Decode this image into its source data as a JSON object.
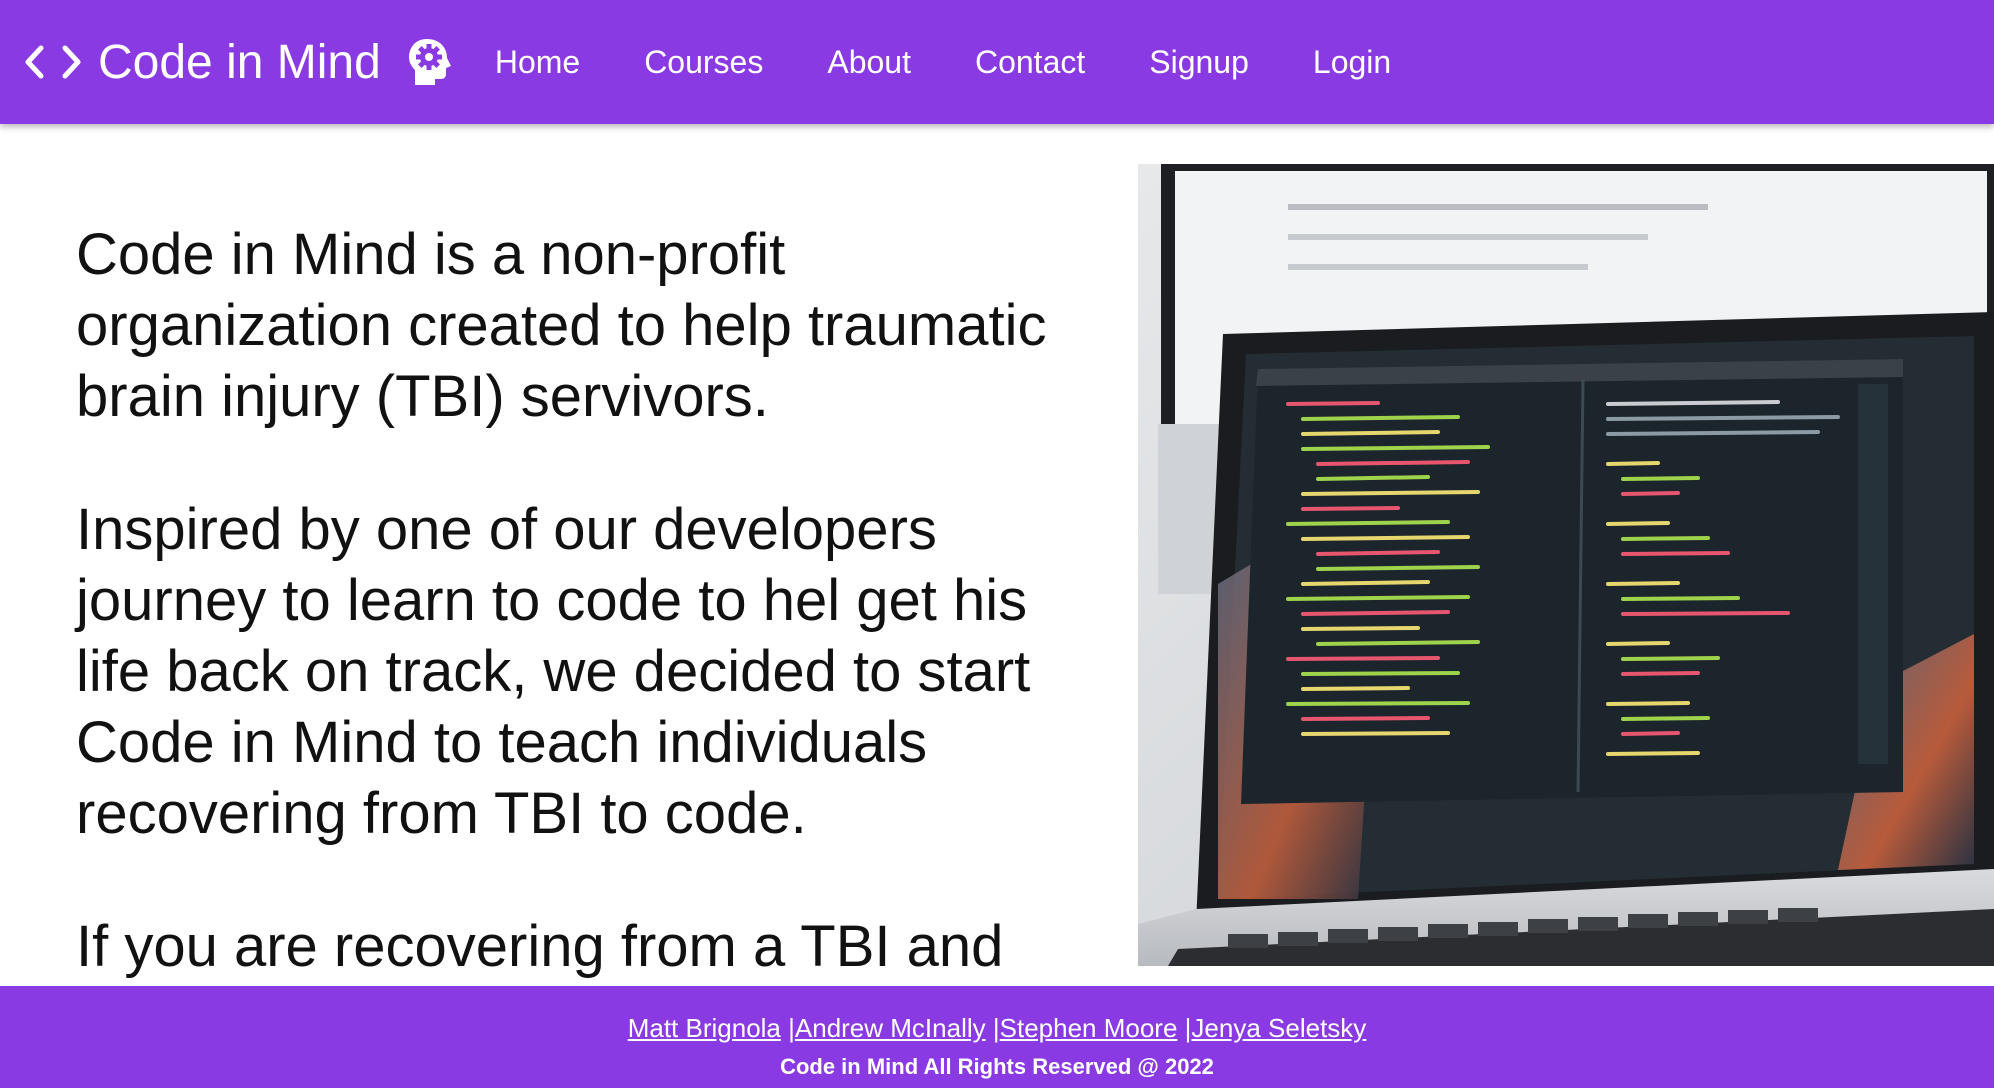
{
  "header": {
    "brand_title": "Code in Mind",
    "nav": [
      "Home",
      "Courses",
      "About",
      "Contact",
      "Signup",
      "Login"
    ]
  },
  "intro": {
    "paragraphs": [
      "Code in Mind is a non-profit organization created to help traumatic brain injury (TBI) servivors.",
      "Inspired by one of our developers journey to learn to code to hel get his life back on track, we decided to start Code in Mind to teach individuals recovering from TBI to code.",
      "If you are recovering from a TBI and"
    ]
  },
  "footer": {
    "authors": [
      "Matt Brignola",
      "Andrew McInally",
      "Stephen Moore",
      "Jenya Seletsky"
    ],
    "separator": "|",
    "copyright": "Code in Mind All Rights Reserved @ 2022"
  },
  "icons": {
    "brand": "code-brackets-icon",
    "brain": "brain-gear-icon"
  },
  "colors": {
    "brand_purple": "#8a3ae3",
    "text": "#111111",
    "white": "#ffffff"
  }
}
